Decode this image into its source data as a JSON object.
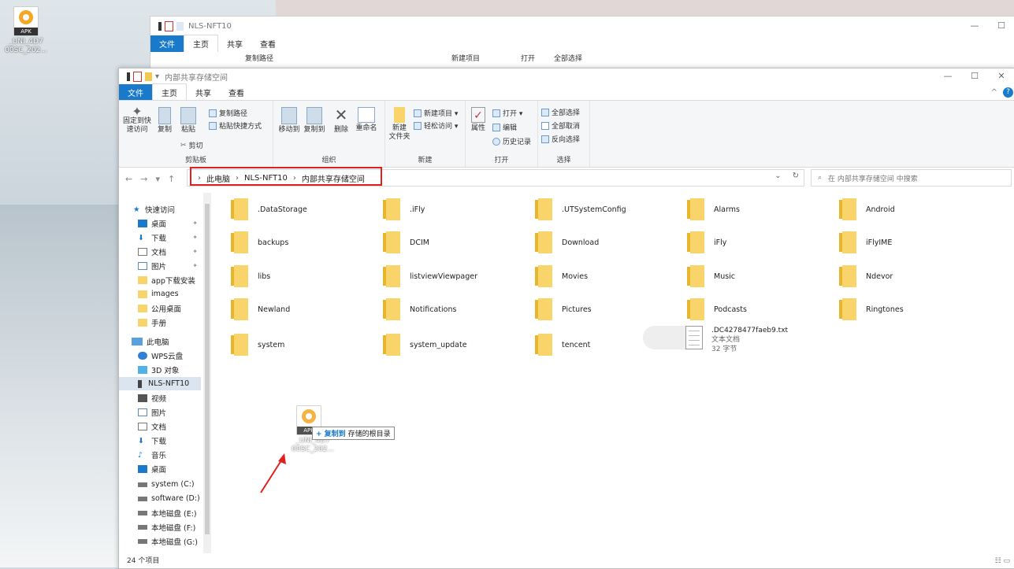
{
  "desktop": {
    "icon_badge": "APK",
    "icon_label_1": "_UNI_4D7",
    "icon_label_2": "00SC_202..."
  },
  "back_window": {
    "title": "NLS-NFT10",
    "tabs": [
      "文件",
      "主页",
      "共享",
      "查看"
    ],
    "ribbon_items": [
      "复制路径",
      "新建项目",
      "打开",
      "全部选择"
    ],
    "minimize": "—",
    "maximize": "☐"
  },
  "window": {
    "title": "内部共享存储空间",
    "tabs": [
      "文件",
      "主页",
      "共享",
      "查看"
    ],
    "minimize": "—",
    "maximize": "☐",
    "close": "✕",
    "help": "?",
    "collapse": "^"
  },
  "ribbon": {
    "clipboard": {
      "label": "剪贴板",
      "pin": "固定到快\n速访问",
      "copy": "复制",
      "paste": "粘贴",
      "copy_path": "复制路径",
      "paste_shortcut": "粘贴快捷方式",
      "cut": "剪切"
    },
    "organize": {
      "label": "组织",
      "move_to": "移动到",
      "copy_to": "复制到",
      "delete": "删除",
      "rename": "重命名"
    },
    "new": {
      "label": "新建",
      "new_folder": "新建\n文件夹",
      "new_item": "新建项目 ▾",
      "easy_access": "轻松访问 ▾"
    },
    "open": {
      "label": "打开",
      "properties": "属性",
      "open": "打开 ▾",
      "edit": "编辑",
      "history": "历史记录"
    },
    "select": {
      "label": "选择",
      "select_all": "全部选择",
      "select_none": "全部取消",
      "invert": "反向选择"
    }
  },
  "address": {
    "back": "←",
    "forward": "→",
    "recent": "▾",
    "up": "↑",
    "crumbs": [
      "此电脑",
      "NLS-NFT10",
      "内部共享存储空间"
    ],
    "separator": "›",
    "dropdown": "⌄",
    "refresh": "↻",
    "search_placeholder": "在 内部共享存储空间 中搜索"
  },
  "sidebar": {
    "items": [
      {
        "label": "快速访问",
        "pin": ""
      },
      {
        "label": "桌面",
        "pin": "✦"
      },
      {
        "label": "下载",
        "pin": "✦"
      },
      {
        "label": "文档",
        "pin": "✦"
      },
      {
        "label": "图片",
        "pin": "✦"
      },
      {
        "label": "app下载安装",
        "pin": ""
      },
      {
        "label": "images",
        "pin": ""
      },
      {
        "label": "公用桌面",
        "pin": ""
      },
      {
        "label": "手册",
        "pin": ""
      },
      {
        "label": "此电脑",
        "pin": ""
      },
      {
        "label": "WPS云盘",
        "pin": ""
      },
      {
        "label": "3D 对象",
        "pin": ""
      },
      {
        "label": "NLS-NFT10",
        "pin": ""
      },
      {
        "label": "视频",
        "pin": ""
      },
      {
        "label": "图片",
        "pin": ""
      },
      {
        "label": "文档",
        "pin": ""
      },
      {
        "label": "下载",
        "pin": ""
      },
      {
        "label": "音乐",
        "pin": ""
      },
      {
        "label": "桌面",
        "pin": ""
      },
      {
        "label": "system (C:)",
        "pin": ""
      },
      {
        "label": "software (D:)",
        "pin": ""
      },
      {
        "label": "本地磁盘 (E:)",
        "pin": ""
      },
      {
        "label": "本地磁盘 (F:)",
        "pin": ""
      },
      {
        "label": "本地磁盘 (G:)",
        "pin": ""
      }
    ]
  },
  "folders": [
    ".DataStorage",
    ".iFly",
    ".UTSystemConfig",
    "Alarms",
    "Android",
    "backups",
    "DCIM",
    "Download",
    "iFly",
    "iFlyIME",
    "libs",
    "listviewViewpager",
    "Movies",
    "Music",
    "Ndevor",
    "Newland",
    "Notifications",
    "Pictures",
    "Podcasts",
    "Ringtones",
    "system",
    "system_update",
    "tencent"
  ],
  "txt_file": {
    "name": ".DC4278477faeb9.txt",
    "type": "文本文档",
    "size": "32 字节"
  },
  "drag": {
    "tooltip_action": "+ 复制到",
    "tooltip_target": "存储的根目录"
  },
  "status": {
    "count": "24 个项目",
    "view": "☷ ▭"
  },
  "colors": {
    "accent": "#1979ca",
    "highlight_box": "#e02020",
    "folder": "#f8d46a",
    "arrow": "#e02020"
  }
}
